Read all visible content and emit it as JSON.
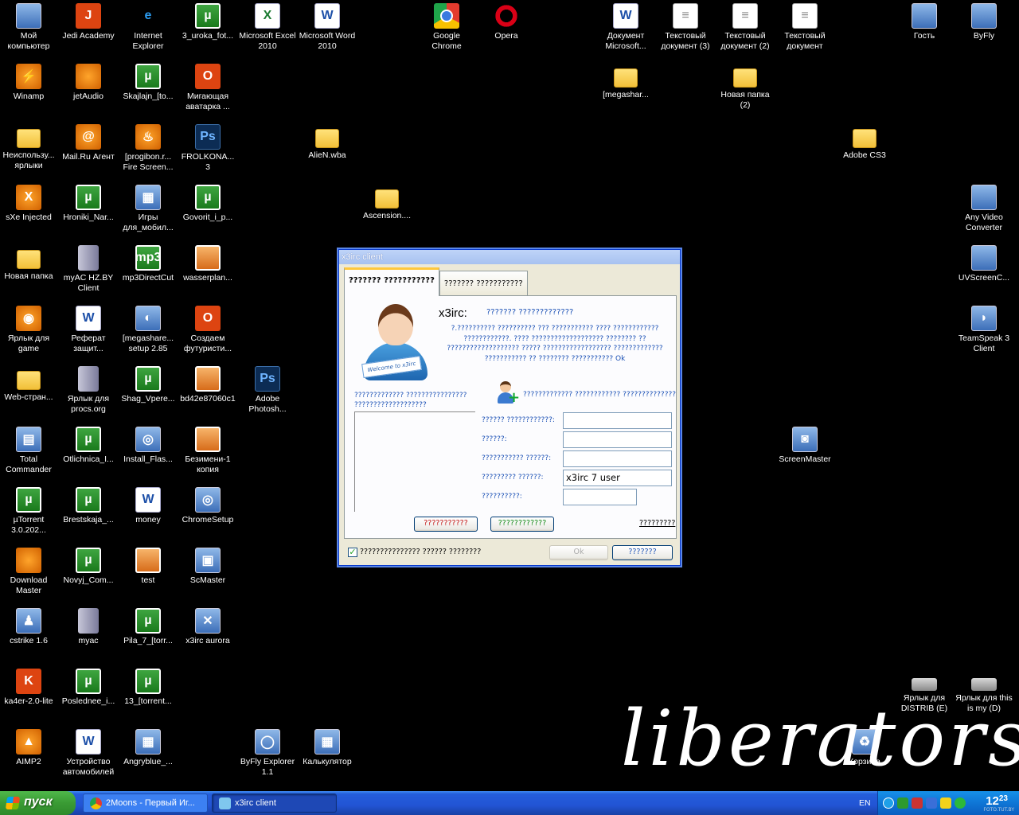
{
  "desktop": {
    "icons": [
      {
        "label": "Мой компьютер",
        "kind": "generic",
        "glyph": ""
      },
      {
        "label": "Jedi Academy",
        "kind": "red",
        "glyph": "J"
      },
      {
        "label": "Internet Explorer",
        "kind": "ie",
        "glyph": "e"
      },
      {
        "label": "3_uroka_fot...",
        "kind": "utor",
        "glyph": "µ"
      },
      {
        "label": "Microsoft Excel 2010",
        "kind": "excel",
        "glyph": "X"
      },
      {
        "label": "Microsoft Word 2010",
        "kind": "word",
        "glyph": "W"
      },
      {
        "label": "Google Chrome",
        "kind": "chrome",
        "glyph": ""
      },
      {
        "label": "Opera",
        "kind": "opera",
        "glyph": ""
      },
      {
        "label": "Документ Microsoft...",
        "kind": "word",
        "glyph": "W"
      },
      {
        "label": "Текстовый документ (3)",
        "kind": "doc",
        "glyph": "≡"
      },
      {
        "label": "Текстовый документ (2)",
        "kind": "doc",
        "glyph": "≡"
      },
      {
        "label": "Текстовый документ",
        "kind": "doc",
        "glyph": "≡"
      },
      {
        "label": "Гость",
        "kind": "generic",
        "glyph": ""
      },
      {
        "label": "ByFly",
        "kind": "generic",
        "glyph": ""
      },
      {
        "label": "Winamp",
        "kind": "orange",
        "glyph": "⚡"
      },
      {
        "label": "jetAudio",
        "kind": "orange",
        "glyph": ""
      },
      {
        "label": "Skajlajn_[to...",
        "kind": "utor",
        "glyph": "µ"
      },
      {
        "label": "Мигающая аватарка ...",
        "kind": "red",
        "glyph": "O"
      },
      {
        "label": "[megashar...",
        "kind": "folder",
        "glyph": ""
      },
      {
        "label": "Новая папка (2)",
        "kind": "folder",
        "glyph": ""
      },
      {
        "label": "Неиспользу... ярлыки",
        "kind": "folder",
        "glyph": ""
      },
      {
        "label": "Mail.Ru Агент",
        "kind": "orange",
        "glyph": "@"
      },
      {
        "label": "[progibon.r... Fire Screen...",
        "kind": "orange",
        "glyph": "♨"
      },
      {
        "label": "FROLKONA... 3",
        "kind": "ps",
        "glyph": "Ps"
      },
      {
        "label": "AlieN.wba",
        "kind": "folder",
        "glyph": ""
      },
      {
        "label": "Adobe CS3",
        "kind": "folder",
        "glyph": ""
      },
      {
        "label": "sXe Injected",
        "kind": "orange",
        "glyph": "X"
      },
      {
        "label": "Hroniki_Nar...",
        "kind": "utor",
        "glyph": "µ"
      },
      {
        "label": "Игры для_мобил...",
        "kind": "generic",
        "glyph": "▦"
      },
      {
        "label": "Govorit_i_p...",
        "kind": "utor",
        "glyph": "µ"
      },
      {
        "label": "Ascension....",
        "kind": "folder",
        "glyph": ""
      },
      {
        "label": "Any Video Converter",
        "kind": "generic",
        "glyph": ""
      },
      {
        "label": "Новая папка",
        "kind": "folder",
        "glyph": ""
      },
      {
        "label": "myAC HZ.BY Client",
        "kind": "shield",
        "glyph": ""
      },
      {
        "label": "mp3DirectCut",
        "kind": "utor",
        "glyph": "mp3"
      },
      {
        "label": "wasserplan...",
        "kind": "img",
        "glyph": ""
      },
      {
        "label": "UVScreenC...",
        "kind": "generic",
        "glyph": ""
      },
      {
        "label": "Ярлык для game",
        "kind": "orange",
        "glyph": "◉"
      },
      {
        "label": "Реферат защит...",
        "kind": "word",
        "glyph": "W"
      },
      {
        "label": "[megashare... setup 2.85",
        "kind": "generic",
        "glyph": "◐"
      },
      {
        "label": "Создаем футуристи...",
        "kind": "red",
        "glyph": "O"
      },
      {
        "label": "TeamSpeak 3 Client",
        "kind": "generic",
        "glyph": "◗"
      },
      {
        "label": "Web-стран...",
        "kind": "folder",
        "glyph": ""
      },
      {
        "label": "Ярлык для procs.org",
        "kind": "shield",
        "glyph": ""
      },
      {
        "label": "Shag_Vpere...",
        "kind": "utor",
        "glyph": "µ"
      },
      {
        "label": "bd42e87060c1",
        "kind": "img",
        "glyph": ""
      },
      {
        "label": "Adobe Photosh...",
        "kind": "ps",
        "glyph": "Ps"
      },
      {
        "label": "Total Commander",
        "kind": "generic",
        "glyph": "▤"
      },
      {
        "label": "Otlichnica_I...",
        "kind": "utor",
        "glyph": "µ"
      },
      {
        "label": "Install_Flas...",
        "kind": "generic",
        "glyph": "◎"
      },
      {
        "label": "Безимени-1 копия",
        "kind": "img",
        "glyph": ""
      },
      {
        "label": "ScreenMaster",
        "kind": "generic",
        "glyph": "◙"
      },
      {
        "label": "µTorrent 3.0.202...",
        "kind": "utor",
        "glyph": "µ"
      },
      {
        "label": "Brestskaja_...",
        "kind": "utor",
        "glyph": "µ"
      },
      {
        "label": "money",
        "kind": "word",
        "glyph": "W"
      },
      {
        "label": "ChromeSetup",
        "kind": "generic",
        "glyph": "◎"
      },
      {
        "label": "Download Master",
        "kind": "orange",
        "glyph": ""
      },
      {
        "label": "Novyj_Com...",
        "kind": "utor",
        "glyph": "µ"
      },
      {
        "label": "test",
        "kind": "img",
        "glyph": ""
      },
      {
        "label": "ScMaster",
        "kind": "generic",
        "glyph": "▣"
      },
      {
        "label": "cstrike 1.6",
        "kind": "generic",
        "glyph": "♟"
      },
      {
        "label": "myac",
        "kind": "shield",
        "glyph": ""
      },
      {
        "label": "Pila_7_[torr...",
        "kind": "utor",
        "glyph": "µ"
      },
      {
        "label": "x3irc aurora",
        "kind": "generic",
        "glyph": "✕"
      },
      {
        "label": "ka4er-2.0-lite",
        "kind": "red",
        "glyph": "K"
      },
      {
        "label": "Poslednee_i...",
        "kind": "utor",
        "glyph": "µ"
      },
      {
        "label": "13_[torrent...",
        "kind": "utor",
        "glyph": "µ"
      },
      {
        "label": "Ярлык для DISTRIB (E)",
        "kind": "drive",
        "glyph": ""
      },
      {
        "label": "Ярлык для this is my (D)",
        "kind": "drive",
        "glyph": ""
      },
      {
        "label": "AIMP2",
        "kind": "orange",
        "glyph": "▲"
      },
      {
        "label": "Устройство автомобилей",
        "kind": "word",
        "glyph": "W"
      },
      {
        "label": "Angryblue_...",
        "kind": "generic",
        "glyph": "▦"
      },
      {
        "label": "ByFly Explorer 1.1",
        "kind": "generic",
        "glyph": "◯"
      },
      {
        "label": "Калькулятор",
        "kind": "generic",
        "glyph": "▦"
      },
      {
        "label": "Корзина",
        "kind": "generic",
        "glyph": "♻"
      }
    ],
    "wallpaper_text": "liberators"
  },
  "window": {
    "title": "x3irc client",
    "tabs": [
      "??????? ???????????",
      "??????? ???????????"
    ],
    "avatar_badge": "Welcome to x3irc",
    "app_name": "x3irc:",
    "app_subtitle": "??????? ?????????????",
    "description": "?.?????????? ?????????? ??? ??????????? ???? ???????????? ????????????. ???? ??????????????????? ???????? ?? ??????????????????? ????? ?????????????????? ????????????? ??????????? ?? ???????? ??????????? Ok",
    "users_label": "????????????? ???????????????? ???????????????????",
    "form_header": "????????????? ???????????? ??????????????",
    "fields": [
      {
        "label": "?????? ????????????:",
        "value": ""
      },
      {
        "label": "??????:",
        "value": ""
      },
      {
        "label": "??????????? ??????:",
        "value": ""
      },
      {
        "label": "????????? ??????:",
        "value": "x3irc 7 user"
      },
      {
        "label": "??????????:",
        "value": ""
      }
    ],
    "btn_red": "???????????",
    "btn_green": "????????????",
    "link": "?????????",
    "checkbox_label": "??????????????? ?????? ????????",
    "checkbox_checked": true,
    "ok_label": "Ok",
    "cancel_label": "???????"
  },
  "taskbar": {
    "start_label": "пуск",
    "buttons": [
      "2Moons - Первый Иг...",
      "x3irc client"
    ],
    "lang": "EN",
    "clock": "12",
    "clock_minutes": "23",
    "watermark": "FOTO.TUT.BY"
  },
  "colors": {
    "accent": "#245edb",
    "start": "#3a9b34",
    "link_blue": "#1d52b6"
  }
}
